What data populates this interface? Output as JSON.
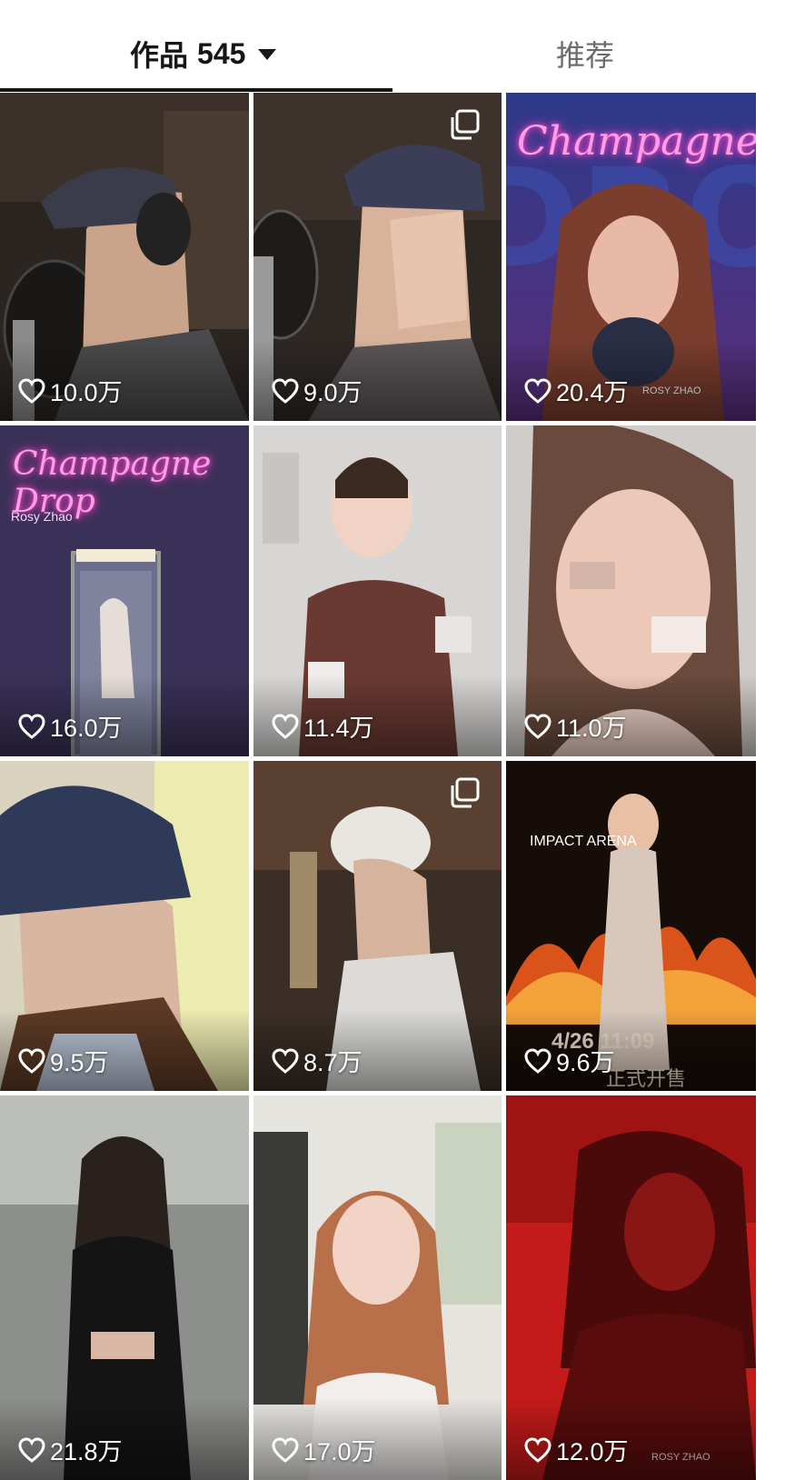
{
  "tabs": {
    "works_label": "作品",
    "works_count": "545",
    "recommend_label": "推荐"
  },
  "posts": [
    {
      "likes": "10.0万",
      "multi_image": false,
      "theme": "studio-recording-cap"
    },
    {
      "likes": "9.0万",
      "multi_image": true,
      "theme": "studio-recording-cap-smile"
    },
    {
      "likes": "20.4万",
      "multi_image": false,
      "theme": "champagne-poster",
      "overlay": "Champagne",
      "overlay_small": "ROSY ZHAO"
    },
    {
      "likes": "16.0万",
      "multi_image": false,
      "theme": "champagne-drop-phonebooth",
      "overlay": "Champagne Drop",
      "overlay_small": "Rosy Zhao"
    },
    {
      "likes": "11.4万",
      "multi_image": false,
      "theme": "glitch-portrait-bun"
    },
    {
      "likes": "11.0万",
      "multi_image": false,
      "theme": "glitch-face-closeup"
    },
    {
      "likes": "9.5万",
      "multi_image": false,
      "theme": "baseball-cap-profile"
    },
    {
      "likes": "8.7万",
      "multi_image": true,
      "theme": "studio-recording-white-cap"
    },
    {
      "likes": "9.6万",
      "multi_image": false,
      "theme": "concert-fire-poster",
      "overlay": "IMPACT ARENA",
      "overlay_date": "4/26 11:09",
      "overlay_sale": "正式开售"
    },
    {
      "likes": "21.8万",
      "multi_image": false,
      "theme": "black-dress-grey"
    },
    {
      "likes": "17.0万",
      "multi_image": false,
      "theme": "backstage-smile"
    },
    {
      "likes": "12.0万",
      "multi_image": false,
      "theme": "red-poster",
      "overlay_small": "ROSY ZHAO"
    }
  ],
  "colors": {
    "tab_active": "#161616",
    "tab_inactive": "#6b6b6b",
    "like_text": "#ffffff"
  }
}
